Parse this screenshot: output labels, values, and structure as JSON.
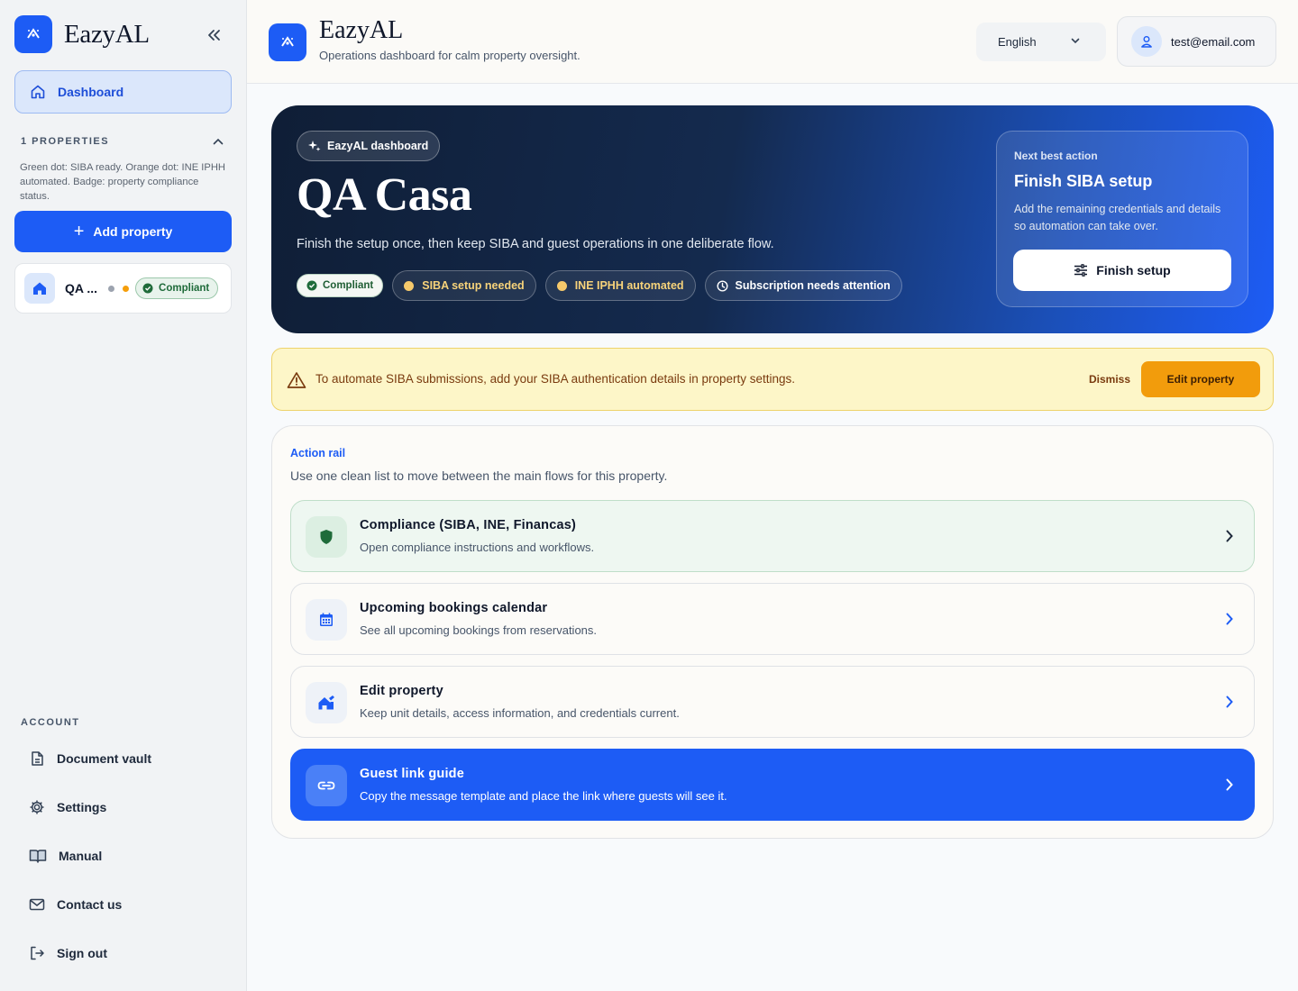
{
  "brand": {
    "name": "EazyAL",
    "accent": "#1d5cf5"
  },
  "sidebar": {
    "dashboard_label": "Dashboard",
    "properties_header": "1 PROPERTIES",
    "legend": "Green dot: SIBA ready. Orange dot: INE IPHH automated. Badge: property compliance status.",
    "add_property": "Add property",
    "property": {
      "name": "QA ...",
      "badge": "Compliant"
    },
    "account_header": "ACCOUNT",
    "account_items": [
      {
        "label": "Document vault",
        "icon": "document-icon"
      },
      {
        "label": "Settings",
        "icon": "gear-icon"
      },
      {
        "label": "Manual",
        "icon": "book-icon"
      },
      {
        "label": "Contact us",
        "icon": "mail-icon"
      },
      {
        "label": "Sign out",
        "icon": "sign-out-icon"
      }
    ]
  },
  "header": {
    "title": "EazyAL",
    "subtitle": "Operations dashboard for calm property oversight.",
    "language": "English",
    "user_email": "test@email.com"
  },
  "hero": {
    "chip": "EazyAL dashboard",
    "title": "QA Casa",
    "subtitle": "Finish the setup once, then keep SIBA and guest operations in one deliberate flow.",
    "badges": {
      "compliant": "Compliant",
      "siba": "SIBA setup needed",
      "ine": "INE IPHH automated",
      "subscription": "Subscription needs attention"
    },
    "next": {
      "eyebrow": "Next best action",
      "title": "Finish SIBA setup",
      "description": "Add the remaining credentials and details so automation can take over.",
      "button": "Finish setup"
    }
  },
  "alert": {
    "text": "To automate SIBA submissions, add your SIBA authentication details in property settings.",
    "dismiss": "Dismiss",
    "action": "Edit property"
  },
  "rail": {
    "eyebrow": "Action rail",
    "subtitle": "Use one clean list to move between the main flows for this property.",
    "items": [
      {
        "title": "Compliance (SIBA, INE, Financas)",
        "description": "Open compliance instructions and workflows.",
        "icon": "shield-icon"
      },
      {
        "title": "Upcoming bookings calendar",
        "description": "See all upcoming bookings from reservations.",
        "icon": "calendar-icon"
      },
      {
        "title": "Edit property",
        "description": "Keep unit details, access information, and credentials current.",
        "icon": "home-edit-icon"
      },
      {
        "title": "Guest link guide",
        "description": "Copy the message template and place the link where guests will see it.",
        "icon": "link-icon"
      }
    ]
  }
}
